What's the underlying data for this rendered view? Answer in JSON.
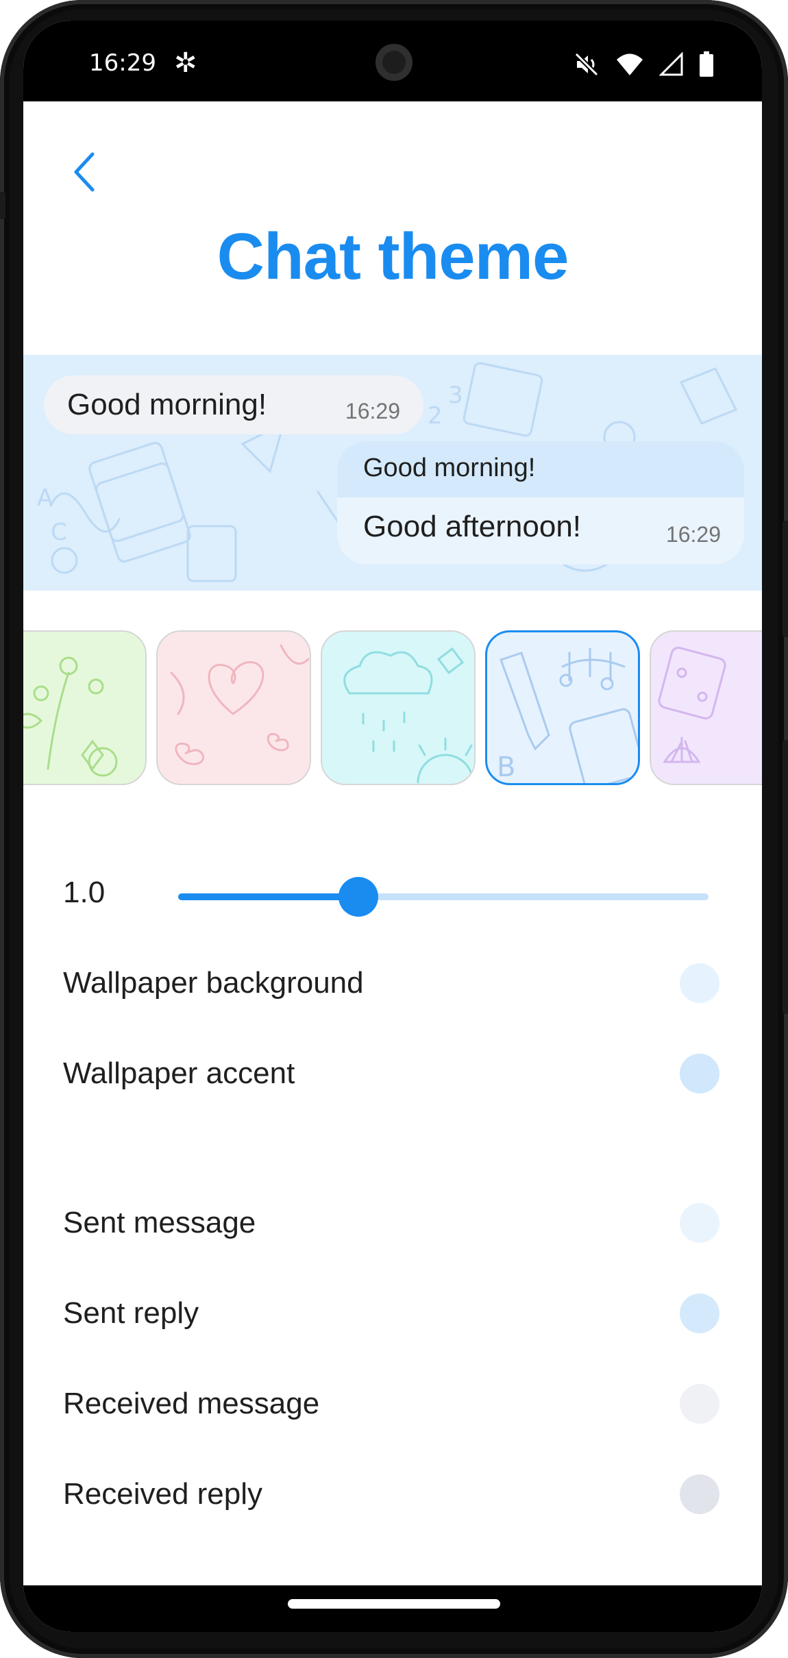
{
  "status_bar": {
    "time": "16:29",
    "app_glyph": "✲",
    "icons": [
      "mute-icon",
      "wifi-icon",
      "signal-icon",
      "battery-icon"
    ]
  },
  "header": {
    "back_icon": "chevron-left-icon",
    "title": "Chat theme"
  },
  "preview": {
    "incoming": {
      "text": "Good morning!",
      "time": "16:29"
    },
    "outgoing": {
      "reply_text": "Good morning!",
      "text": "Good afternoon!",
      "time": "16:29"
    },
    "background_color": "#ddeefc"
  },
  "wallpapers": [
    {
      "name": "floral",
      "color": "#e6f8dc",
      "stroke": "#a9de8a",
      "selected": false
    },
    {
      "name": "hearts",
      "color": "#fbe7ea",
      "stroke": "#f0b6be",
      "selected": false
    },
    {
      "name": "weather",
      "color": "#d8f7f8",
      "stroke": "#8fdde2",
      "selected": false
    },
    {
      "name": "school",
      "color": "#e6f2fe",
      "stroke": "#a9cbef",
      "selected": true
    },
    {
      "name": "games",
      "color": "#f1e6fb",
      "stroke": "#d3b6ef",
      "selected": false
    }
  ],
  "slider": {
    "value_label": "1.0",
    "fraction": 0.34
  },
  "settings": [
    {
      "label": "Wallpaper background",
      "color": "#e6f3fe"
    },
    {
      "label": "Wallpaper accent",
      "color": "#d0e7fc"
    },
    {
      "label": "Sent message",
      "color": "#eaf4fd"
    },
    {
      "label": "Sent reply",
      "color": "#d4e9fb"
    },
    {
      "label": "Received message",
      "color": "#eff1f5"
    },
    {
      "label": "Received reply",
      "color": "#e2e4ec"
    }
  ],
  "accent_color": "#1a8cf0"
}
